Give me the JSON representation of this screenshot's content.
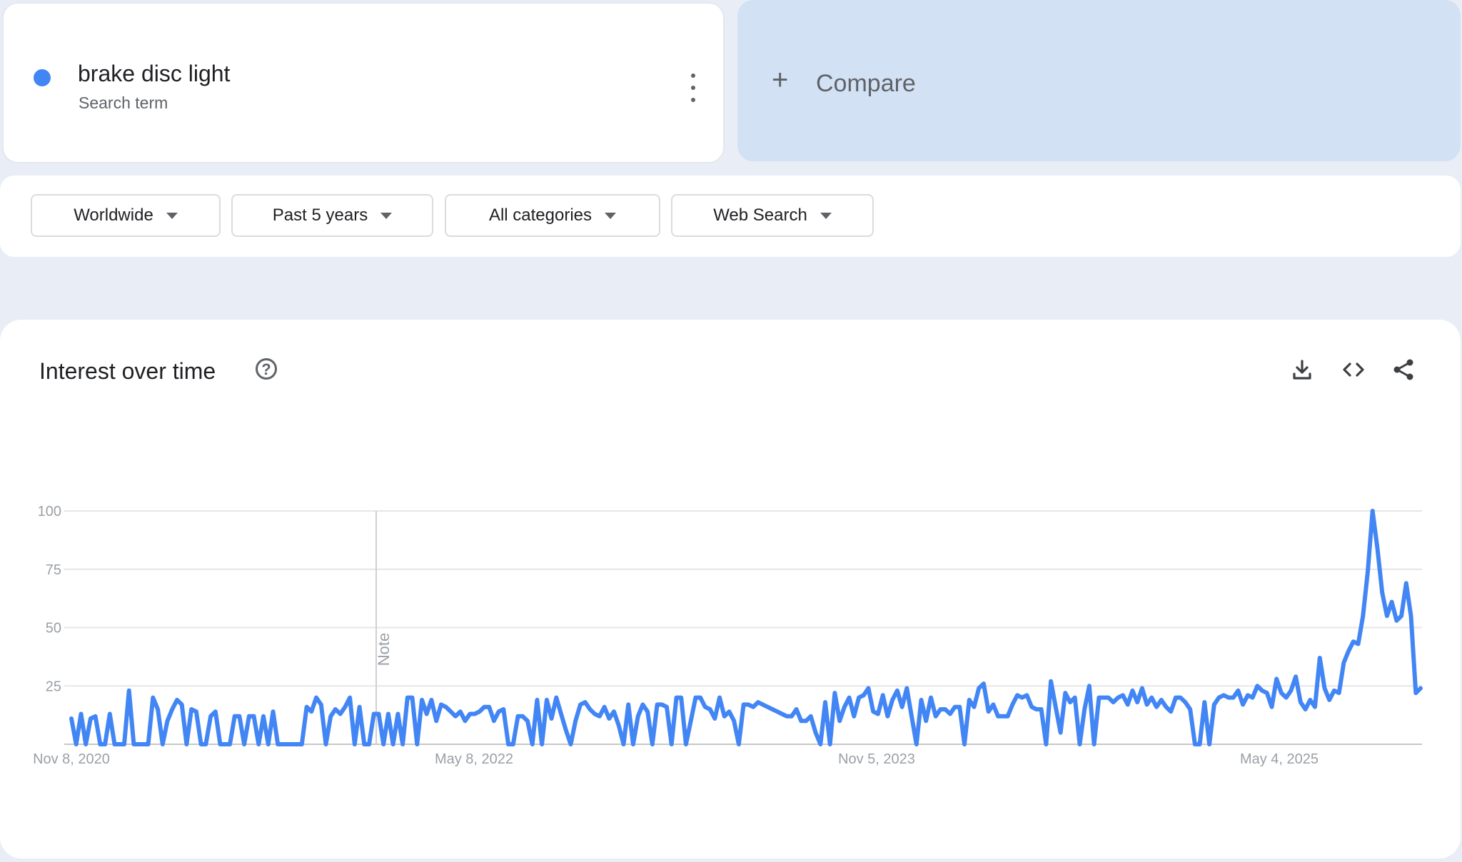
{
  "term": {
    "name": "brake disc light",
    "subtitle": "Search term",
    "color": "#4285f4"
  },
  "compare": {
    "label": "Compare",
    "icon": "plus-icon"
  },
  "filters": [
    {
      "label": "Worldwide"
    },
    {
      "label": "Past 5 years"
    },
    {
      "label": "All categories"
    },
    {
      "label": "Web Search"
    }
  ],
  "chart": {
    "title": "Interest over time",
    "actions": [
      "download-icon",
      "embed-code-icon",
      "share-icon"
    ],
    "note_label": "Note"
  },
  "chart_data": {
    "type": "line",
    "series": [
      {
        "color": "#4285f4"
      }
    ],
    "x_ticks": [
      "Nov 8, 2020",
      "May 8, 2022",
      "Nov 5, 2023",
      "May 4, 2025"
    ],
    "y_ticks": [
      "100",
      "75",
      "50",
      "25"
    ],
    "ylim": [
      0,
      100
    ],
    "grid": true,
    "note_date": "2021-11",
    "values": [
      11,
      0,
      13,
      0,
      11,
      12,
      0,
      0,
      13,
      0,
      0,
      0,
      23,
      0,
      0,
      0,
      0,
      20,
      15,
      0,
      10,
      15,
      19,
      17,
      0,
      15,
      14,
      0,
      0,
      12,
      14,
      0,
      0,
      0,
      12,
      12,
      0,
      12,
      12,
      0,
      12,
      0,
      14,
      0,
      0,
      0,
      0,
      0,
      0,
      16,
      14,
      20,
      17,
      0,
      12,
      15,
      13,
      16,
      20,
      0,
      16,
      0,
      0,
      13,
      13,
      0,
      13,
      0,
      13,
      0,
      20,
      20,
      0,
      19,
      13,
      19,
      10,
      17,
      16,
      14,
      12,
      14,
      10,
      13,
      13,
      14,
      16,
      16,
      10,
      14,
      15,
      0,
      0,
      12,
      12,
      10,
      0,
      19,
      0,
      19,
      11,
      20,
      13,
      6,
      0,
      10,
      17,
      18,
      15,
      13,
      12,
      16,
      11,
      14,
      8,
      0,
      17,
      0,
      12,
      17,
      14,
      0,
      17,
      17,
      16,
      0,
      20,
      20,
      0,
      10,
      20,
      20,
      16,
      15,
      11,
      20,
      12,
      14,
      10,
      0,
      17,
      17,
      16,
      18,
      17,
      16,
      15,
      14,
      13,
      12,
      12,
      15,
      10,
      10,
      12,
      5,
      0,
      18,
      0,
      22,
      10,
      16,
      20,
      12,
      20,
      21,
      24,
      14,
      13,
      21,
      12,
      19,
      23,
      16,
      24,
      12,
      0,
      19,
      10,
      20,
      12,
      15,
      15,
      13,
      16,
      16,
      0,
      19,
      16,
      24,
      26,
      14,
      17,
      12,
      12,
      12,
      17,
      21,
      20,
      21,
      16,
      15,
      15,
      0,
      27,
      16,
      5,
      22,
      18,
      20,
      0,
      15,
      25,
      0,
      20,
      20,
      20,
      18,
      20,
      21,
      17,
      23,
      18,
      24,
      17,
      20,
      16,
      19,
      16,
      14,
      20,
      20,
      18,
      15,
      0,
      0,
      18,
      0,
      17,
      20,
      21,
      20,
      20,
      23,
      17,
      21,
      20,
      25,
      23,
      22,
      16,
      28,
      22,
      20,
      23,
      29,
      18,
      15,
      19,
      16,
      37,
      24,
      19,
      23,
      22,
      35,
      40,
      44,
      43,
      55,
      74,
      100,
      84,
      65,
      55,
      61,
      53,
      55,
      69,
      55,
      22,
      24
    ]
  }
}
